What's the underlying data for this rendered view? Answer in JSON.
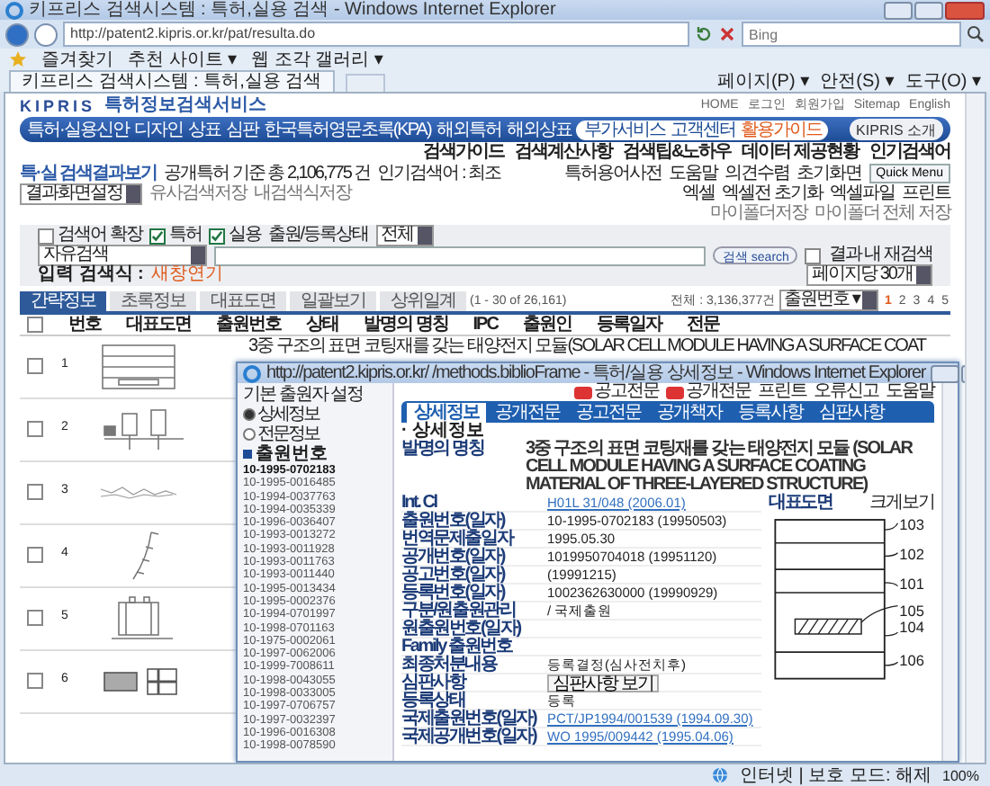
{
  "window": {
    "title": "키프리스 검색시스템 : 특허,실용 검색 - Windows Internet Explorer"
  },
  "address_bar": {
    "url": "http://patent2.kipris.or.kr/pat/resulta.do",
    "search_placeholder": "Bing"
  },
  "favorites_bar": {
    "label": "즐겨찾기",
    "items": [
      "추천 사이트 ▾",
      "웹 조각 갤러리 ▾"
    ]
  },
  "tab": {
    "title": "키프리스 검색시스템 : 특허,실용 검색"
  },
  "command_bar": [
    "페이지(P) ▾",
    "안전(S) ▾",
    "도구(O) ▾"
  ],
  "site": {
    "logo": "KIPRIS",
    "service_name": "특허정보검색서비스",
    "top_links": [
      "HOME",
      "로그인",
      "회원가입",
      "Sitemap",
      "English"
    ],
    "nav": [
      "특허·실용신안",
      "디자인",
      "상표",
      "심판",
      "한국특허영문초록(KPA)",
      "해외특허",
      "해외상표"
    ],
    "nav_pill": [
      "부가서비스",
      "고객센터",
      "활용가이드"
    ],
    "about_button": "KIPRIS 소개",
    "sub_links": [
      "검색가이드",
      "검색계산사항",
      "검색팁&노하우",
      "데이터 제공현황",
      "인기검색어"
    ]
  },
  "results": {
    "title": "특·실 검색결과보기",
    "count_text": "공개특허 기준 총 2,106,775 건",
    "popular": "인기검색어 : 최조",
    "tools": [
      "특허용어사전",
      "도움말",
      "의견수렴",
      "초기화면"
    ],
    "quick_menu": "Quick Menu",
    "view_select": "결과화면설정",
    "save_links": [
      "유사검색저장",
      "내검색식저장"
    ],
    "actions": [
      "엑셀",
      "엑셀전 초기화",
      "엑셀파일",
      "프린트"
    ],
    "actions_2": [
      "마이폴더저장",
      "마이폴더 전체 저장"
    ]
  },
  "filter": {
    "options": [
      {
        "label": "검색어 확장",
        "checked": false
      },
      {
        "label": "특허",
        "checked": true
      },
      {
        "label": "실용",
        "checked": true
      }
    ],
    "status_label": "출원/등록상태",
    "status_value": "전체",
    "field_select": "자유검색",
    "search_button": "검색 search",
    "refine": {
      "label": "결과 내 재검색",
      "checked": false
    },
    "per_page": "페이지당 30개",
    "expression_label": "입력 검색식 :",
    "expression_link": "새창연기"
  },
  "result_tabs": [
    {
      "label": "간략정보",
      "selected": true
    },
    {
      "label": "초록정보",
      "selected": false
    },
    {
      "label": "대표도면",
      "selected": false
    },
    {
      "label": "일괄보기",
      "selected": false
    },
    {
      "label": "상위일계",
      "selected": false
    }
  ],
  "range": "(1 - 30 of 26,161)",
  "total": "전체 : 3,136,377건",
  "sort": "출원번호 ▾",
  "pages": [
    {
      "label": "1",
      "selected": true
    },
    {
      "label": "2",
      "selected": false
    },
    {
      "label": "3",
      "selected": false
    },
    {
      "label": "4",
      "selected": false
    },
    {
      "label": "5",
      "selected": false
    }
  ],
  "table": {
    "select_all": {
      "checked": false
    },
    "columns": [
      "번호",
      "대표도면",
      "출원번호",
      "상태",
      "발명의 명칭",
      "IPC",
      "출원인",
      "등록일자",
      "전문"
    ],
    "rows": [
      {
        "number": "1",
        "checked": false,
        "title": "3중 구조의 표면 코팅재를 갖는 태양전지 모듈(SOLAR CELL MODULE HAVING A SURFACE COAT"
      },
      {
        "number": "2",
        "checked": false
      },
      {
        "number": "3",
        "checked": false
      },
      {
        "number": "4",
        "checked": false
      },
      {
        "number": "5",
        "checked": false
      },
      {
        "number": "6",
        "checked": false
      }
    ]
  },
  "popup": {
    "title": "http://patent2.kipris.or.kr/ /methods.biblioFrame - 특허/실용 상세정보 - Windows Internet Explorer",
    "side": {
      "heading": "기본 출원자 설정",
      "views": [
        {
          "label": "상세정보",
          "selected": true
        },
        {
          "label": "전문정보",
          "selected": false
        }
      ],
      "list_title": "출원번호",
      "numbers": [
        {
          "text": "10-1995-0702183",
          "selected": true
        },
        {
          "text": "10-1995-0016485",
          "selected": false
        },
        {
          "text": "10-1994-0037763",
          "selected": false
        },
        {
          "text": "10-1994-0035339",
          "selected": false
        },
        {
          "text": "10-1996-0036407",
          "selected": false
        },
        {
          "text": "10-1993-0013272",
          "selected": false
        },
        {
          "text": "10-1993-0011928",
          "selected": false
        },
        {
          "text": "10-1993-0011763",
          "selected": false
        },
        {
          "text": "10-1993-0011440",
          "selected": false
        },
        {
          "text": "10-1995-0013434",
          "selected": false
        },
        {
          "text": "10-1995-0002376",
          "selected": false
        },
        {
          "text": "10-1994-0701997",
          "selected": false
        },
        {
          "text": "10-1998-0701163",
          "selected": false
        },
        {
          "text": "10-1975-0002061",
          "selected": false
        },
        {
          "text": "10-1997-0062006",
          "selected": false
        },
        {
          "text": "10-1999-7008611",
          "selected": false
        },
        {
          "text": "10-1998-0043055",
          "selected": false
        },
        {
          "text": "10-1998-0033005",
          "selected": false
        },
        {
          "text": "10-1997-0706757",
          "selected": false
        },
        {
          "text": "10-1997-0032397",
          "selected": false
        },
        {
          "text": "10-1996-0016308",
          "selected": false
        },
        {
          "text": "10-1998-0078590",
          "selected": false
        }
      ]
    },
    "doc_links": [
      "공고전문",
      "공개전문"
    ],
    "tools": [
      "프린트",
      "오류신고",
      "도움말"
    ],
    "tabs": [
      {
        "label": "상세정보",
        "selected": true
      },
      {
        "label": "공개전문",
        "selected": false
      },
      {
        "label": "공고전문",
        "selected": false
      },
      {
        "label": "공개책자",
        "selected": false
      },
      {
        "label": "등록사항",
        "selected": false
      },
      {
        "label": "심판사항",
        "selected": false
      }
    ],
    "section": "· 상세정보",
    "invention_title": {
      "label": "발명의 명칭",
      "value": "3중 구조의 표면 코팅재를 갖는 태양전지 모듈 (SOLAR CELL MODULE HAVING A SURFACE COATING MATERIAL OF THREE-LAYERED STRUCTURE)"
    },
    "fields": [
      {
        "label": "Int. Cl",
        "value": "H01L 31/048 (2006.01)",
        "kind": "link"
      },
      {
        "label": "출원번호(일자)",
        "value": "10-1995-0702183 (19950503)",
        "kind": "text"
      },
      {
        "label": "번역문제출일자",
        "value": "1995.05.30",
        "kind": "text"
      },
      {
        "label": "공개번호(일자)",
        "value": "1019950704018 (19951120)",
        "kind": "text"
      },
      {
        "label": "공고번호(일자)",
        "value": "(19991215)",
        "kind": "text"
      },
      {
        "label": "등록번호(일자)",
        "value": "1002362630000 (19990929)",
        "kind": "text"
      },
      {
        "label": "구분/원출원관리",
        "value": "/ 국제출원",
        "kind": "text"
      },
      {
        "label": "원출원번호(일자)",
        "kind": "text"
      },
      {
        "label": "Family 출원번호",
        "kind": "text"
      },
      {
        "label": "최종처분내용",
        "value": "등록결정(심사전치후)",
        "kind": "text"
      },
      {
        "label": "심판사항",
        "value": "심판사항 보기",
        "kind": "button"
      },
      {
        "label": "등록상태",
        "value": "등록",
        "kind": "text"
      },
      {
        "label": "국제출원번호(일자)",
        "value": "PCT/JP1994/001539 (1994.09.30)",
        "kind": "link"
      },
      {
        "label": "국제공개번호(일자)",
        "value": "WO 1995/009442 (1995.04.06)",
        "kind": "link"
      }
    ],
    "figure": {
      "label": "대표도면",
      "zoom_link": "크게보기",
      "labels": [
        "103",
        "102",
        "101",
        "105",
        "104",
        "106"
      ]
    }
  },
  "status_bar": {
    "zone": "인터넷 | 보호 모드: 해제",
    "zoom": "100%"
  }
}
